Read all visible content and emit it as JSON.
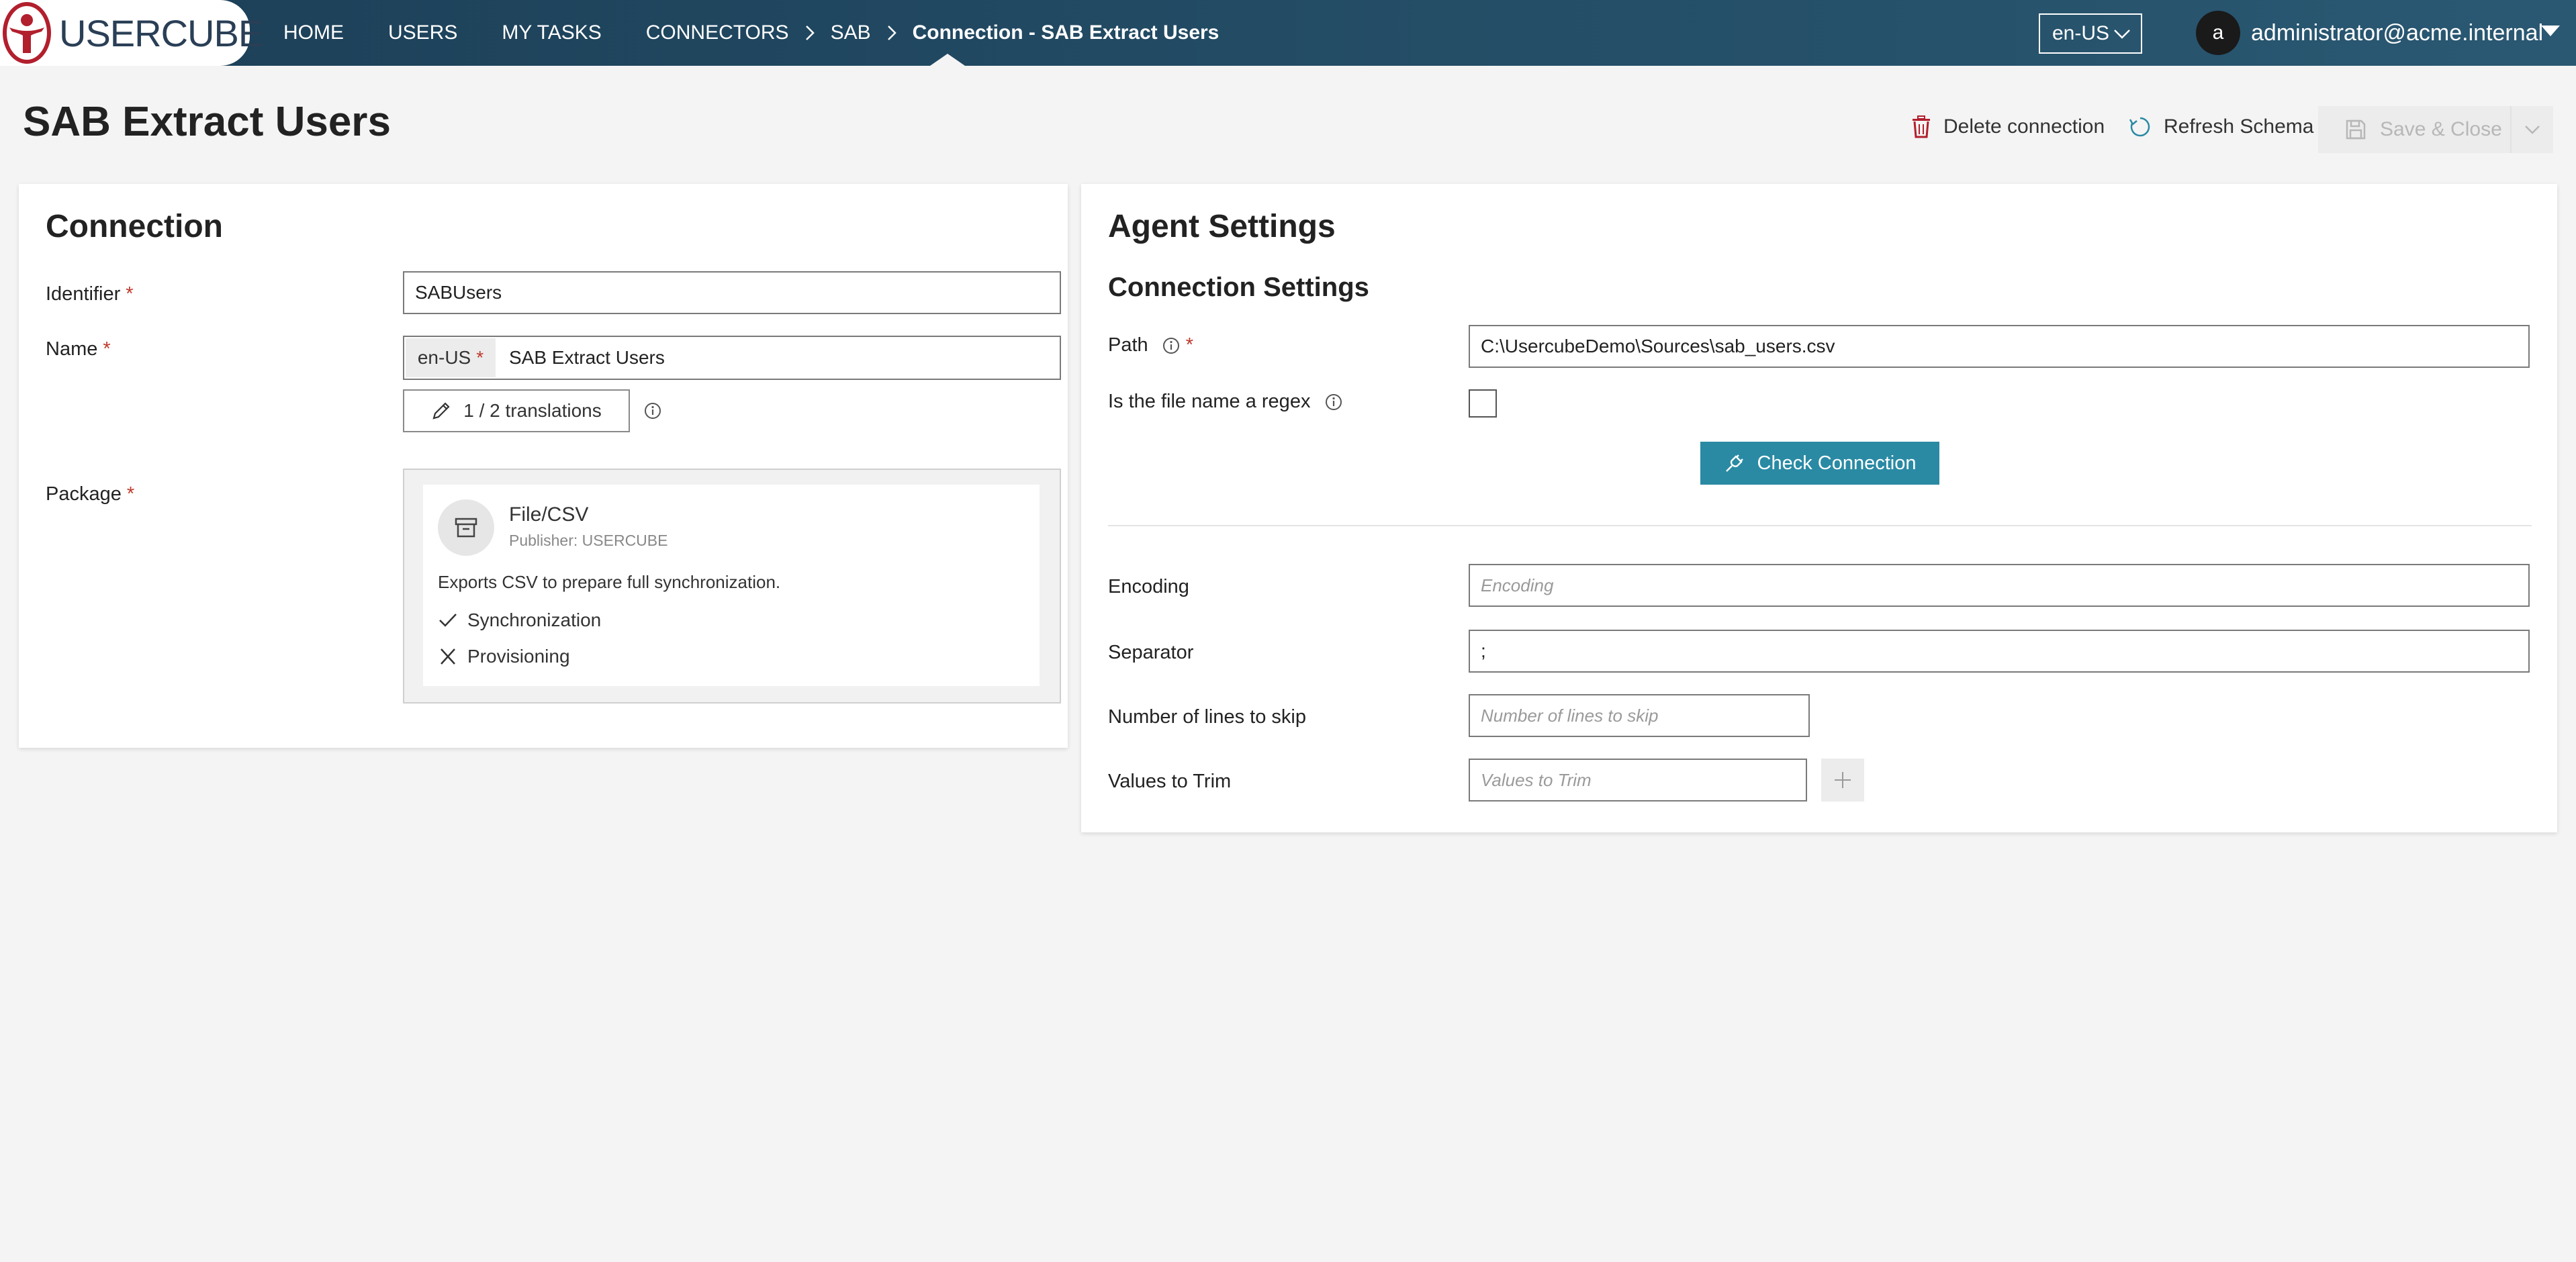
{
  "header": {
    "logo_text": "USERCUBE",
    "nav": [
      "HOME",
      "USERS",
      "MY TASKS"
    ],
    "breadcrumb": [
      "CONNECTORS",
      "SAB"
    ],
    "breadcrumb_current": "Connection - SAB Extract Users",
    "language": "en-US",
    "user_initial": "a",
    "user_name": "administrator@acme.internal"
  },
  "page": {
    "title": "SAB Extract Users",
    "actions": {
      "delete": "Delete connection",
      "refresh": "Refresh Schema",
      "save": "Save & Close"
    }
  },
  "connection": {
    "title": "Connection",
    "identifier_label": "Identifier",
    "identifier_value": "SABUsers",
    "name_label": "Name",
    "name_lang": "en-US",
    "name_value": "SAB Extract Users",
    "translations": "1 / 2 translations",
    "package_label": "Package",
    "package": {
      "name": "File/CSV",
      "publisher": "Publisher: USERCUBE",
      "description": "Exports CSV to prepare full synchronization.",
      "capabilities": [
        {
          "label": "Synchronization",
          "enabled": true
        },
        {
          "label": "Provisioning",
          "enabled": false
        }
      ]
    }
  },
  "agent": {
    "title": "Agent Settings",
    "section_title": "Connection Settings",
    "path_label": "Path",
    "path_value": "C:\\UsercubeDemo\\Sources\\sab_users.csv",
    "regex_label": "Is the file name a regex",
    "check_button": "Check Connection",
    "encoding_label": "Encoding",
    "encoding_placeholder": "Encoding",
    "separator_label": "Separator",
    "separator_value": ";",
    "skip_label": "Number of lines to skip",
    "skip_placeholder": "Number of lines to skip",
    "trim_label": "Values to Trim",
    "trim_placeholder": "Values to Trim"
  },
  "colors": {
    "header": "#1c3f57",
    "accent": "#2a8aa4",
    "required": "#c0392b",
    "logo": "#b21f2d"
  }
}
